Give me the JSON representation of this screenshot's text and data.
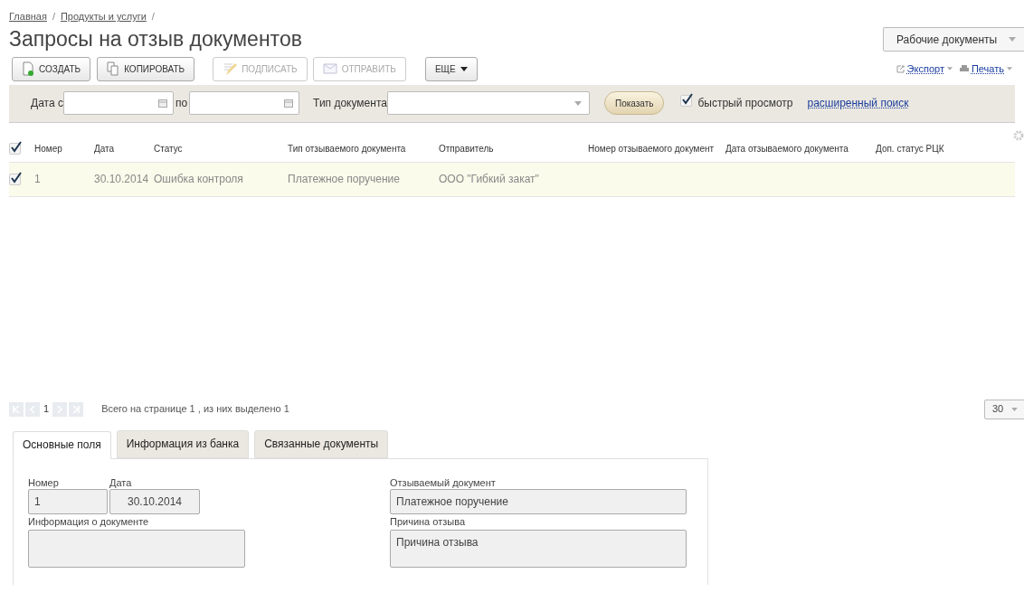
{
  "breadcrumbs": [
    "Главная",
    "Продукты и услуги"
  ],
  "breadcrumb_separator": "/",
  "title": "Запросы на отзыв документов",
  "workspace_select": {
    "value": "Рабочие документы"
  },
  "toolbar": [
    {
      "label": "СОЗДАТЬ",
      "kind": "create",
      "disabled": false
    },
    {
      "label": "КОПИРОВАТЬ",
      "kind": "copy",
      "disabled": false
    },
    {
      "label": "ПОДПИСАТЬ",
      "kind": "sign",
      "disabled": true
    },
    {
      "label": "ОТПРАВИТЬ",
      "kind": "send",
      "disabled": true
    },
    {
      "label": "ЕЩЕ",
      "kind": "more",
      "disabled": false
    }
  ],
  "actions": [
    {
      "label": "Экспорт",
      "kind": "export"
    },
    {
      "label": "Печать",
      "kind": "print"
    }
  ],
  "filter": {
    "date_from_label": "Дата с",
    "date_to_label": "по",
    "doc_type_label": "Тип документа",
    "show_button": "Показать",
    "quick_view": {
      "label": "быстрый просмотр",
      "checked": true
    },
    "advanced_link": "расширенный поиск"
  },
  "table": {
    "select_all_checked": true,
    "columns": [
      "Номер",
      "Дата",
      "Статус",
      "Тип отзываемого документа",
      "Отправитель",
      "Номер отзываемого документ",
      "Дата отзываемого документа",
      "Доп. статус РЦК"
    ],
    "rows": [
      {
        "selected": true,
        "cells": [
          "1",
          "30.10.2014",
          "Ошибка контроля",
          "Платежное поручение",
          "ООО \"Гибкий закат\"",
          "",
          "",
          ""
        ]
      }
    ]
  },
  "pager": {
    "page": "1",
    "summary": "Всего на странице 1 , из них выделено 1",
    "page_size": "30"
  },
  "tabs": [
    {
      "label": "Основные поля",
      "selected": true
    },
    {
      "label": "Информация из банка",
      "selected": false
    },
    {
      "label": "Связанные документы",
      "selected": false
    }
  ],
  "form": {
    "number": {
      "label": "Номер",
      "value": "1"
    },
    "date": {
      "label": "Дата",
      "value": "30.10.2014"
    },
    "doc_info": {
      "label": "Информация о документе"
    },
    "revoked_doc": {
      "label": "Отзываемый документ",
      "value": "Платежное поручение"
    },
    "reason": {
      "label": "Причина отзыва",
      "value": "Причина отзыва"
    }
  }
}
